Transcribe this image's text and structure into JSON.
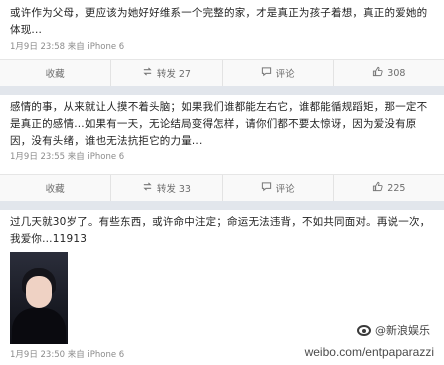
{
  "posts": [
    {
      "text": "或许作为父母，更应该为她好好维系一个完整的家，才是真正为孩子着想，真正的爱她的体现...",
      "meta": "1月9日 23:58 来自 iPhone 6",
      "actions": {
        "collect": "收藏",
        "repost": "转发 27",
        "comment": "评论",
        "like": "308"
      }
    },
    {
      "text": "感情的事，从来就让人摸不着头脑；如果我们谁都能左右它，谁都能循规蹈矩，那一定不是真正的感情...如果有一天，无论结局变得怎样，请你们都不要太惊讶，因为爱没有原因，没有头绪，谁也无法抗拒它的力量...",
      "meta": "1月9日 23:55 来自 iPhone 6",
      "actions": {
        "collect": "收藏",
        "repost": "转发 33",
        "comment": "评论",
        "like": "225"
      }
    },
    {
      "text": "过几天就30岁了。有些东西，或许命中注定；命运无法违背，不如共同面对。再说一次，我爱你...11913",
      "meta": "1月9日 23:50 来自 iPhone 6"
    }
  ],
  "watermark": {
    "handle": "@新浪娱乐",
    "url": "weibo.com/entpaparazzi"
  },
  "icons": {
    "repost": "repost-icon",
    "comment": "comment-icon",
    "like": "thumbs-up-icon"
  }
}
